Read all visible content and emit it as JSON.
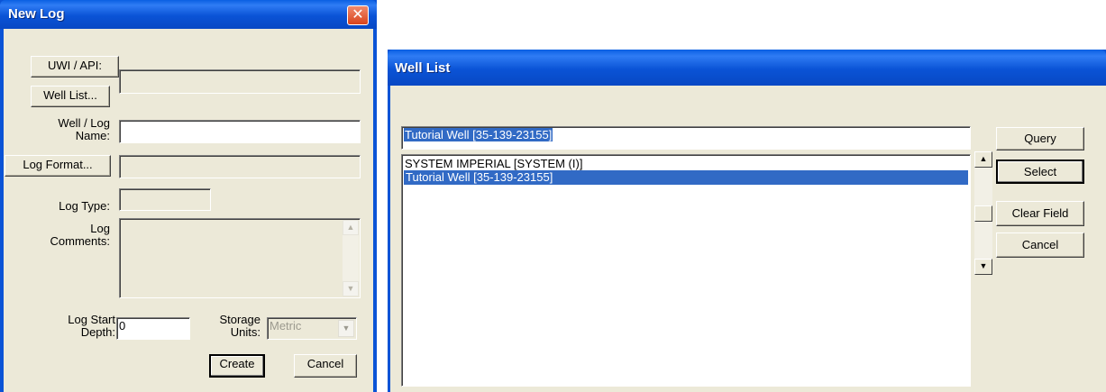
{
  "new_log": {
    "title": "New Log",
    "close_glyph": "✕",
    "uwi_button": "UWI / API:",
    "uwi_value": "",
    "well_list_button": "Well List...",
    "well_log_name_label_1": "Well / Log",
    "well_log_name_label_2": "Name:",
    "well_log_name_value": "",
    "log_format_button": "Log Format...",
    "log_format_value": "",
    "log_type_label": "Log Type:",
    "log_type_value": "",
    "log_comments_label_1": "Log",
    "log_comments_label_2": "Comments:",
    "log_comments_value": "",
    "log_start_label_1": "Log Start",
    "log_start_label_2": "Depth:",
    "log_start_value": "0",
    "storage_units_label_1": "Storage",
    "storage_units_label_2": "Units:",
    "storage_units_value": "Metric",
    "create_button": "Create",
    "cancel_button": "Cancel"
  },
  "well_list": {
    "title": "Well List",
    "search_value": "Tutorial Well  [35-139-23155]",
    "items": [
      "SYSTEM IMPERIAL  [SYSTEM (I)]",
      "Tutorial Well  [35-139-23155]"
    ],
    "selected_index": 1,
    "query_button": "Query",
    "select_button": "Select",
    "clear_field_button": "Clear Field",
    "cancel_button": "Cancel"
  },
  "icons": {
    "scroll_up": "▲",
    "scroll_down": "▼",
    "dropdown": "▼"
  },
  "colors": {
    "title_bar": "#0a53d6",
    "dialog_face": "#ece9d8",
    "selection": "#316ac5"
  }
}
